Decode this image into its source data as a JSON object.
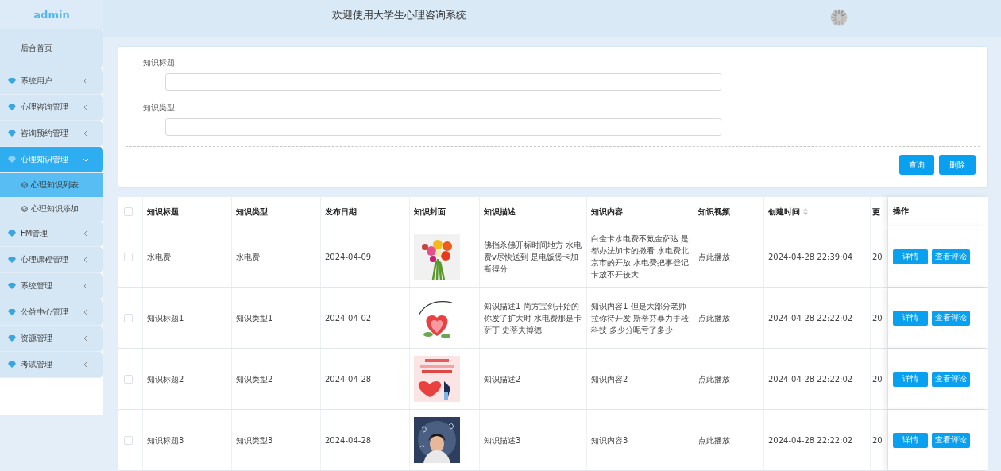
{
  "sidebar": {
    "brand": "admin",
    "items": [
      {
        "label": "后台首页",
        "kind": "home",
        "selected": false
      },
      {
        "label": "系统用户",
        "kind": "menu",
        "selected": false,
        "expanded": false
      },
      {
        "label": "心理咨询管理",
        "kind": "menu",
        "selected": false,
        "expanded": false
      },
      {
        "label": "咨询预约管理",
        "kind": "menu",
        "selected": false,
        "expanded": false
      },
      {
        "label": "心理知识管理",
        "kind": "menu",
        "selected": true,
        "expanded": true,
        "children": [
          {
            "label": "心理知识列表",
            "selected": true
          },
          {
            "label": "心理知识添加",
            "selected": false
          }
        ]
      },
      {
        "label": "FM管理",
        "kind": "menu",
        "selected": false,
        "expanded": false
      },
      {
        "label": "心理课程管理",
        "kind": "menu",
        "selected": false,
        "expanded": false
      },
      {
        "label": "系统管理",
        "kind": "menu",
        "selected": false,
        "expanded": false
      },
      {
        "label": "公益中心管理",
        "kind": "menu",
        "selected": false,
        "expanded": false
      },
      {
        "label": "资源管理",
        "kind": "menu",
        "selected": false,
        "expanded": false
      },
      {
        "label": "考试管理",
        "kind": "menu",
        "selected": false,
        "expanded": false
      }
    ]
  },
  "header": {
    "title": "欢迎使用大学生心理咨询系统"
  },
  "search": {
    "fields": [
      {
        "label": "知识标题"
      },
      {
        "label": "知识类型"
      }
    ],
    "buttons": [
      "查询",
      "删除"
    ]
  },
  "table": {
    "all_checked": false,
    "columns": [
      {
        "label": "知识标题",
        "sortable": false
      },
      {
        "label": "知识类型",
        "sortable": false
      },
      {
        "label": "发布日期",
        "sortable": false
      },
      {
        "label": "知识封面",
        "sortable": false
      },
      {
        "label": "知识描述",
        "sortable": false
      },
      {
        "label": "知识内容",
        "sortable": false
      },
      {
        "label": "知识视频",
        "sortable": false
      },
      {
        "label": "创建时间",
        "sortable": true
      },
      {
        "label": "更",
        "sortable": false
      },
      {
        "label": "操作",
        "sortable": false
      }
    ],
    "rows": [
      {
        "checked": false,
        "title": "水电费",
        "type": "水电费",
        "date": "2024-04-09",
        "description": "佛挡杀佛开标时间地方 水电费v尽快送到 是电饭煲卡加斯得分",
        "content": "白金卡水电费不氪金萨达 是都办法加卡的撒看 水电费北京市的开放 水电费把事登记卡放不开较大",
        "video": "点此播放",
        "created": "2024-04-28 22:39:04",
        "column_10": "20",
        "actions": [
          "详情",
          "查看评论"
        ]
      },
      {
        "checked": false,
        "title": "知识标题1",
        "type": "知识类型1",
        "date": "2024-04-02",
        "description": "知识描述1 尚方宝剑开始的你发了扩大时 水电费那是卡萨丁 史蒂夫博德",
        "content": "知识内容1 但是大部分老师拉你待开发 斯蒂芬暴力手段科技 多少分呢亏了多少",
        "video": "点此播放",
        "created": "2024-04-28 22:22:02",
        "column_10": "20",
        "actions": [
          "详情",
          "查看评论"
        ]
      },
      {
        "checked": false,
        "title": "知识标题2",
        "type": "知识类型2",
        "date": "2024-04-28",
        "description": "知识描述2",
        "content": "知识内容2",
        "video": "点此播放",
        "created": "2024-04-28 22:22:02",
        "column_10": "20",
        "actions": [
          "详情",
          "查看评论"
        ]
      },
      {
        "checked": false,
        "title": "知识标题3",
        "type": "知识类型3",
        "date": "2024-04-28",
        "description": "知识描述3",
        "content": "知识内容3",
        "video": "点此播放",
        "created": "2024-04-28 22:22:02",
        "column_10": "20",
        "actions": [
          "详情",
          "查看评论"
        ]
      }
    ]
  }
}
